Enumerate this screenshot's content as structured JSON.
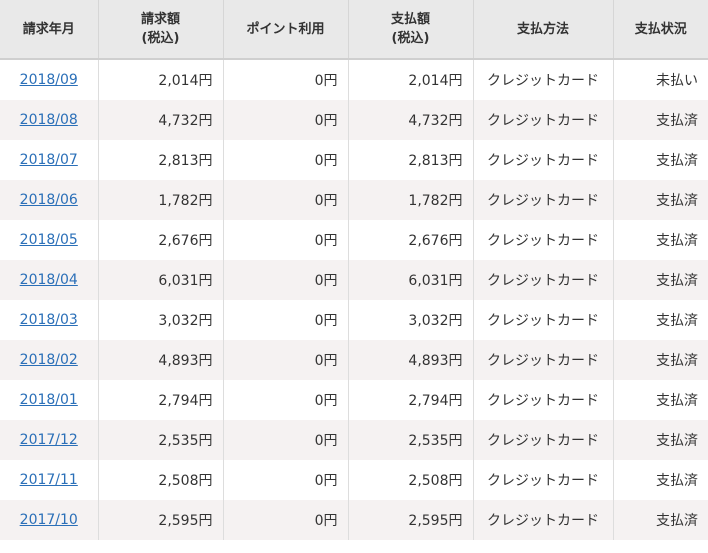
{
  "table": {
    "headers": {
      "month": "請求年月",
      "billed_line1": "請求額",
      "billed_line2": "(税込)",
      "points": "ポイント利用",
      "paid_line1": "支払額",
      "paid_line2": "(税込)",
      "method": "支払方法",
      "status": "支払状況"
    },
    "rows": [
      {
        "month": "2018/09",
        "billed": "2,014円",
        "points": "0円",
        "paid": "2,014円",
        "method": "クレジットカード",
        "status": "未払い"
      },
      {
        "month": "2018/08",
        "billed": "4,732円",
        "points": "0円",
        "paid": "4,732円",
        "method": "クレジットカード",
        "status": "支払済"
      },
      {
        "month": "2018/07",
        "billed": "2,813円",
        "points": "0円",
        "paid": "2,813円",
        "method": "クレジットカード",
        "status": "支払済"
      },
      {
        "month": "2018/06",
        "billed": "1,782円",
        "points": "0円",
        "paid": "1,782円",
        "method": "クレジットカード",
        "status": "支払済"
      },
      {
        "month": "2018/05",
        "billed": "2,676円",
        "points": "0円",
        "paid": "2,676円",
        "method": "クレジットカード",
        "status": "支払済"
      },
      {
        "month": "2018/04",
        "billed": "6,031円",
        "points": "0円",
        "paid": "6,031円",
        "method": "クレジットカード",
        "status": "支払済"
      },
      {
        "month": "2018/03",
        "billed": "3,032円",
        "points": "0円",
        "paid": "3,032円",
        "method": "クレジットカード",
        "status": "支払済"
      },
      {
        "month": "2018/02",
        "billed": "4,893円",
        "points": "0円",
        "paid": "4,893円",
        "method": "クレジットカード",
        "status": "支払済"
      },
      {
        "month": "2018/01",
        "billed": "2,794円",
        "points": "0円",
        "paid": "2,794円",
        "method": "クレジットカード",
        "status": "支払済"
      },
      {
        "month": "2017/12",
        "billed": "2,535円",
        "points": "0円",
        "paid": "2,535円",
        "method": "クレジットカード",
        "status": "支払済"
      },
      {
        "month": "2017/11",
        "billed": "2,508円",
        "points": "0円",
        "paid": "2,508円",
        "method": "クレジットカード",
        "status": "支払済"
      },
      {
        "month": "2017/10",
        "billed": "2,595円",
        "points": "0円",
        "paid": "2,595円",
        "method": "クレジットカード",
        "status": "支払済"
      }
    ]
  },
  "colors": {
    "header_bg": "#e9e9e9",
    "row_alt_bg": "#f5f2f2",
    "link": "#2a6fb8",
    "text": "#333333"
  }
}
